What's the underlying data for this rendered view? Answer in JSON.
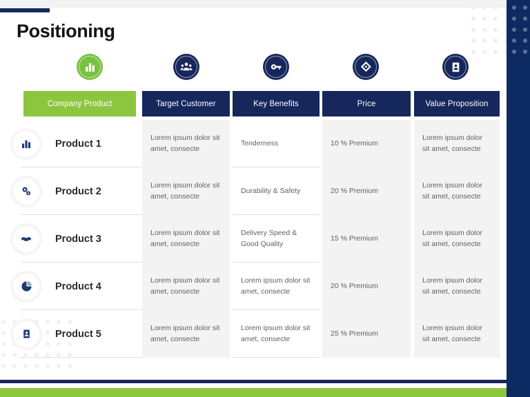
{
  "slide": {
    "title": "Positioning",
    "accent_green": "#8cc63e",
    "accent_navy": "#16275c",
    "panel_navy": "#0e2a63"
  },
  "columns": [
    {
      "label": "Company Product",
      "icon": "bar-chart-icon",
      "style": "green"
    },
    {
      "label": "Target Customer",
      "icon": "user-group-icon",
      "style": "navy"
    },
    {
      "label": "Key Benefits",
      "icon": "key-icon",
      "style": "navy"
    },
    {
      "label": "Price",
      "icon": "price-tag-icon",
      "style": "navy"
    },
    {
      "label": "Value Proposition",
      "icon": "id-card-icon",
      "style": "navy"
    }
  ],
  "rows": [
    {
      "name": "Product 1",
      "icon": "bar-chart-icon",
      "target_customer": "Lorem ipsum dolor sit amet, consecte",
      "key_benefits": "Tenderness",
      "price": "10 % Premium",
      "value_proposition": "Lorem ipsum dolor sit amet, consecte"
    },
    {
      "name": "Product 2",
      "icon": "gears-icon",
      "target_customer": "Lorem ipsum dolor sit amet, consecte",
      "key_benefits": "Durability & Safety",
      "price": "20 % Premium",
      "value_proposition": "Lorem ipsum dolor sit amet, consecte"
    },
    {
      "name": "Product 3",
      "icon": "handshake-icon",
      "target_customer": "Lorem ipsum dolor sit amet, consecte",
      "key_benefits": "Delivery  Speed & Good Quality",
      "price": "15 % Premium",
      "value_proposition": "Lorem ipsum dolor sit amet, consecte"
    },
    {
      "name": "Product 4",
      "icon": "pie-chart-icon",
      "target_customer": "Lorem ipsum dolor sit amet, consecte",
      "key_benefits": "Lorem ipsum dolor sit amet, consecte",
      "price": "20 % Premium",
      "value_proposition": "Lorem ipsum dolor sit amet, consecte"
    },
    {
      "name": "Product 5",
      "icon": "id-card-icon",
      "target_customer": "Lorem ipsum dolor sit amet, consecte",
      "key_benefits": "Lorem ipsum dolor sit amet, consecte",
      "price": "25 % Premium",
      "value_proposition": "Lorem ipsum dolor sit amet, consecte"
    }
  ]
}
